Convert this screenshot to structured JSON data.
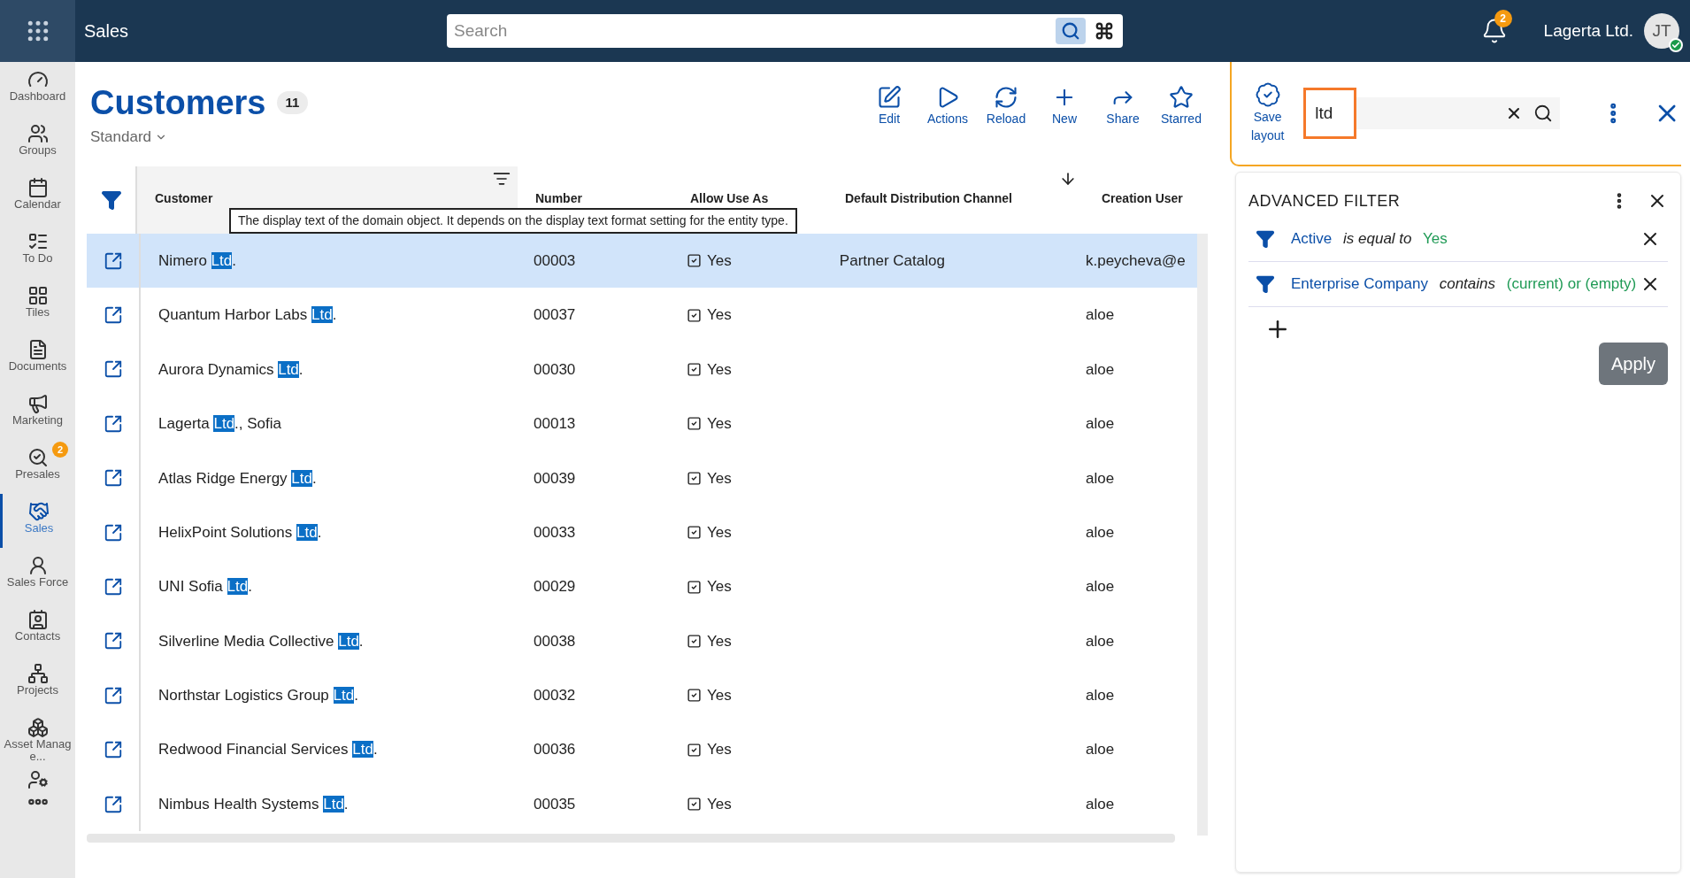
{
  "app": {
    "title": "Sales",
    "search": {
      "placeholder": "Search"
    },
    "notifications": "2",
    "company": "Lagerta Ltd.",
    "avatar": "JT",
    "online": true
  },
  "sidebar": [
    {
      "label": "Dashboard",
      "selected": false
    },
    {
      "label": "Groups",
      "selected": false
    },
    {
      "label": "Calendar",
      "selected": false
    },
    {
      "label": "To Do",
      "selected": false
    },
    {
      "label": "Tiles",
      "selected": false
    },
    {
      "label": "Documents",
      "selected": false
    },
    {
      "label": "Marketing",
      "selected": false
    },
    {
      "label": "Presales",
      "selected": false,
      "badge": "2"
    },
    {
      "label": "Sales",
      "selected": true
    },
    {
      "label": "Sales Force",
      "selected": false
    },
    {
      "label": "Contacts",
      "selected": false
    },
    {
      "label": "Projects",
      "selected": false
    },
    {
      "label": "Asset Manage...",
      "selected": false
    }
  ],
  "page": {
    "title": "Customers",
    "count": "11",
    "view": "Standard"
  },
  "toolbar": [
    {
      "label": "Edit"
    },
    {
      "label": "Actions"
    },
    {
      "label": "Reload"
    },
    {
      "label": "New"
    },
    {
      "label": "Share"
    },
    {
      "label": "Starred"
    }
  ],
  "table": {
    "columns": [
      "Customer",
      "Number",
      "Allow Use As",
      "Default Distribution Channel",
      "Creation User"
    ],
    "tooltip": "The display text of the domain object. It depends on the display text format setting for the entity type.",
    "rows": [
      {
        "name_parts": [
          {
            "text": "Nimero ",
            "highlight": false
          },
          {
            "text": "Ltd",
            "highlight": true
          },
          {
            "text": ".",
            "highlight": false
          }
        ],
        "number": "00003",
        "primary": "Yes",
        "checked": true,
        "channel": "Partner Catalog",
        "user": "k.peycheva@e",
        "selected": true
      },
      {
        "name_parts": [
          {
            "text": "Quantum Harbor Labs ",
            "highlight": false
          },
          {
            "text": "Ltd",
            "highlight": true
          },
          {
            "text": ".",
            "highlight": false
          }
        ],
        "number": "00037",
        "primary": "Yes",
        "checked": true,
        "user": "aloe",
        "selected": false
      },
      {
        "name_parts": [
          {
            "text": "Aurora Dynamics ",
            "highlight": false
          },
          {
            "text": "Ltd",
            "highlight": true
          },
          {
            "text": ".",
            "highlight": false
          }
        ],
        "number": "00030",
        "primary": "Yes",
        "checked": true,
        "user": "aloe",
        "selected": false
      },
      {
        "name_parts": [
          {
            "text": "Lagerta ",
            "highlight": false
          },
          {
            "text": "Ltd",
            "highlight": true
          },
          {
            "text": "., Sofia",
            "highlight": false
          }
        ],
        "number": "00013",
        "primary": "Yes",
        "checked": true,
        "user": "aloe",
        "selected": false
      },
      {
        "name_parts": [
          {
            "text": "Atlas Ridge Energy ",
            "highlight": false
          },
          {
            "text": "Ltd",
            "highlight": true
          },
          {
            "text": ".",
            "highlight": false
          }
        ],
        "number": "00039",
        "primary": "Yes",
        "checked": true,
        "user": "aloe",
        "selected": false
      },
      {
        "name_parts": [
          {
            "text": "HelixPoint Solutions ",
            "highlight": false
          },
          {
            "text": "Ltd",
            "highlight": true
          },
          {
            "text": ".",
            "highlight": false
          }
        ],
        "number": "00033",
        "primary": "Yes",
        "checked": true,
        "user": "aloe",
        "selected": false
      },
      {
        "name_parts": [
          {
            "text": "UNI Sofia ",
            "highlight": false
          },
          {
            "text": "Ltd",
            "highlight": true
          },
          {
            "text": ".",
            "highlight": false
          }
        ],
        "number": "00029",
        "primary": "Yes",
        "checked": true,
        "user": "aloe",
        "selected": false
      },
      {
        "name_parts": [
          {
            "text": "Silverline Media Collective ",
            "highlight": false
          },
          {
            "text": "Ltd",
            "highlight": true
          },
          {
            "text": ".",
            "highlight": false
          }
        ],
        "number": "00038",
        "primary": "Yes",
        "checked": true,
        "user": "aloe",
        "selected": false
      },
      {
        "name_parts": [
          {
            "text": "Northstar Logistics Group ",
            "highlight": false
          },
          {
            "text": "Ltd",
            "highlight": true
          },
          {
            "text": ".",
            "highlight": false
          }
        ],
        "number": "00032",
        "primary": "Yes",
        "checked": true,
        "user": "aloe",
        "selected": false
      },
      {
        "name_parts": [
          {
            "text": "Redwood Financial Services ",
            "highlight": false
          },
          {
            "text": "Ltd",
            "highlight": true
          },
          {
            "text": ".",
            "highlight": false
          }
        ],
        "number": "00036",
        "primary": "Yes",
        "checked": true,
        "user": "aloe",
        "selected": false
      },
      {
        "name_parts": [
          {
            "text": "Nimbus Health Systems ",
            "highlight": false
          },
          {
            "text": "Ltd",
            "highlight": true
          },
          {
            "text": ".",
            "highlight": false
          }
        ],
        "number": "00035",
        "primary": "Yes",
        "checked": true,
        "user": "aloe",
        "selected": false
      }
    ]
  },
  "filter_panel": {
    "save_layout": "Save layout",
    "search_value": "ltd",
    "title": "ADVANCED FILTER",
    "conditions": [
      {
        "field": "Active",
        "operator": "is equal to",
        "value": "Yes"
      },
      {
        "field": "Enterprise Company",
        "operator": "contains",
        "value": "(current) or (empty)"
      }
    ],
    "apply": "Apply"
  }
}
